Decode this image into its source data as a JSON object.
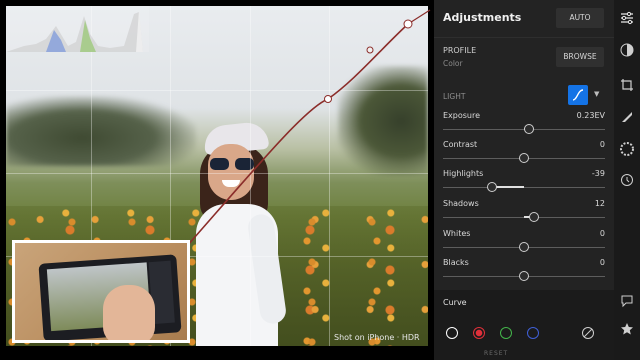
{
  "canvas": {
    "watermark": "Shot on iPhone · HDR"
  },
  "panel": {
    "title": "Adjustments",
    "auto_label": "AUTO",
    "profile_label": "PROFILE",
    "profile_value": "Color",
    "browse_label": "BROWSE",
    "light_label": "LIGHT",
    "sliders": [
      {
        "name": "Exposure",
        "value": "0.23EV",
        "level": 0.53
      },
      {
        "name": "Contrast",
        "value": "0",
        "level": 0.5
      },
      {
        "name": "Highlights",
        "value": "-39",
        "level": 0.3
      },
      {
        "name": "Shadows",
        "value": "12",
        "level": 0.56
      },
      {
        "name": "Whites",
        "value": "0",
        "level": 0.5
      },
      {
        "name": "Blacks",
        "value": "0",
        "level": 0.5
      }
    ],
    "curve_label": "Curve",
    "channels": [
      {
        "name": "luminance",
        "color": "#ffffff"
      },
      {
        "name": "red",
        "color": "#e0303a"
      },
      {
        "name": "green",
        "color": "#43b54a"
      },
      {
        "name": "blue",
        "color": "#3f5fd6"
      }
    ],
    "reset_hint": "RESET"
  },
  "toolbar": {
    "icons": [
      "sliders-icon",
      "color-circle-icon",
      "crop-rotate-icon",
      "healing-brush-icon",
      "aperture-icon",
      "history-icon",
      "comment-icon",
      "star-icon"
    ]
  },
  "colors": {
    "accent": "#1473e6",
    "curve": "#8b2d2a"
  }
}
